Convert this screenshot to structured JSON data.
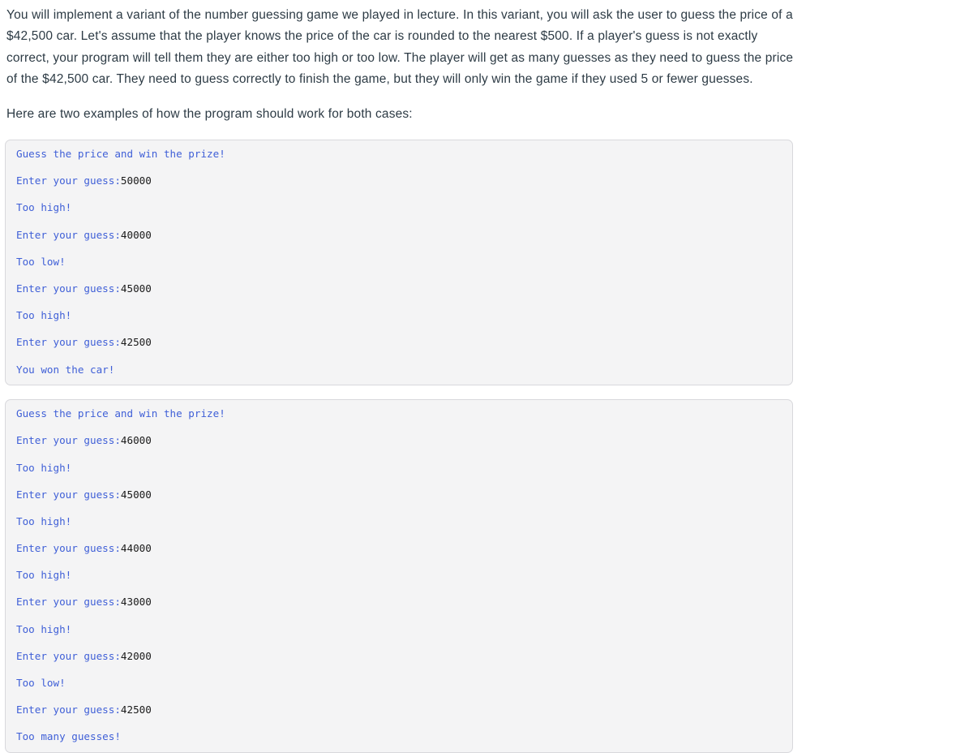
{
  "colors": {
    "page_bg": "#ffffff",
    "prose_text": "#2d3b45",
    "code_bg": "#f4f4f5",
    "code_border": "#d8d8dc",
    "program_output": "#3f5fd7",
    "user_input": "#1a1a1a"
  },
  "prose": {
    "paragraph_1": "You will implement a variant of the number guessing game we played in lecture. In this variant, you will ask the user to guess the price of a $42,500 car. Let's assume that the player knows the price of the car is rounded to the nearest $500.  If a player's guess is not exactly correct, your program will tell them they are either too high or too low.  The player will get as many guesses as they need to guess the price of the $42,500 car.  They need to guess correctly to finish the game, but they will only win the game if they used 5 or fewer guesses.",
    "paragraph_2": "Here are two examples of how the program should work for both cases:"
  },
  "code_blocks": [
    {
      "name": "winning-example",
      "lines": [
        {
          "output": "Guess the price and win the prize!",
          "input": ""
        },
        {
          "output": "Enter your guess:",
          "input": "50000"
        },
        {
          "output": "Too high!",
          "input": ""
        },
        {
          "output": "Enter your guess:",
          "input": "40000"
        },
        {
          "output": "Too low!",
          "input": ""
        },
        {
          "output": "Enter your guess:",
          "input": "45000"
        },
        {
          "output": "Too high!",
          "input": ""
        },
        {
          "output": "Enter your guess:",
          "input": "42500"
        },
        {
          "output": "You won the car!",
          "input": ""
        }
      ]
    },
    {
      "name": "losing-example",
      "lines": [
        {
          "output": "Guess the price and win the prize!",
          "input": ""
        },
        {
          "output": "Enter your guess:",
          "input": "46000"
        },
        {
          "output": "Too high!",
          "input": ""
        },
        {
          "output": "Enter your guess:",
          "input": "45000"
        },
        {
          "output": "Too high!",
          "input": ""
        },
        {
          "output": "Enter your guess:",
          "input": "44000"
        },
        {
          "output": "Too high!",
          "input": ""
        },
        {
          "output": "Enter your guess:",
          "input": "43000"
        },
        {
          "output": "Too high!",
          "input": ""
        },
        {
          "output": "Enter your guess:",
          "input": "42000"
        },
        {
          "output": "Too low!",
          "input": ""
        },
        {
          "output": "Enter your guess:",
          "input": "42500"
        },
        {
          "output": "Too many guesses!",
          "input": ""
        }
      ]
    }
  ]
}
